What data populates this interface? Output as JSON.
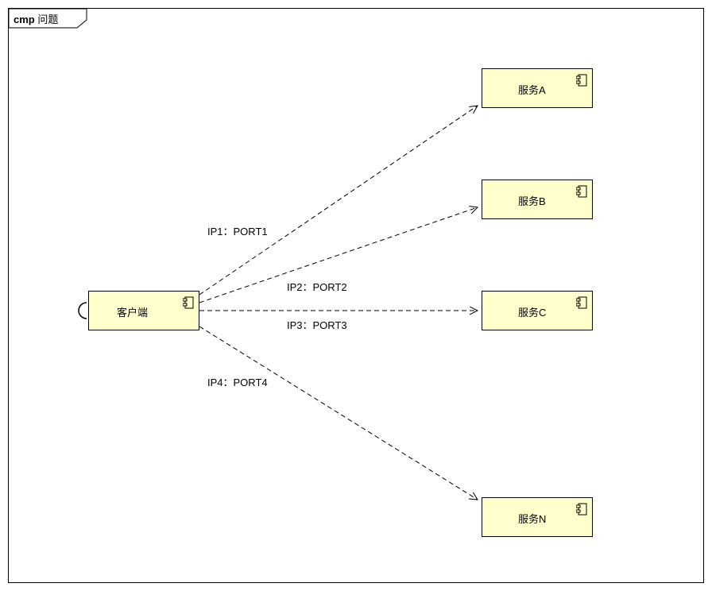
{
  "frame": {
    "prefix": "cmp",
    "title": "问题"
  },
  "components": {
    "client": {
      "label": "客户端"
    },
    "serviceA": {
      "label": "服务A"
    },
    "serviceB": {
      "label": "服务B"
    },
    "serviceC": {
      "label": "服务C"
    },
    "serviceN": {
      "label": "服务N"
    }
  },
  "edges": {
    "e1": {
      "label": "IP1：PORT1"
    },
    "e2": {
      "label": "IP2：PORT2"
    },
    "e3": {
      "label": "IP3：PORT3"
    },
    "e4": {
      "label": "IP4：PORT4"
    }
  }
}
